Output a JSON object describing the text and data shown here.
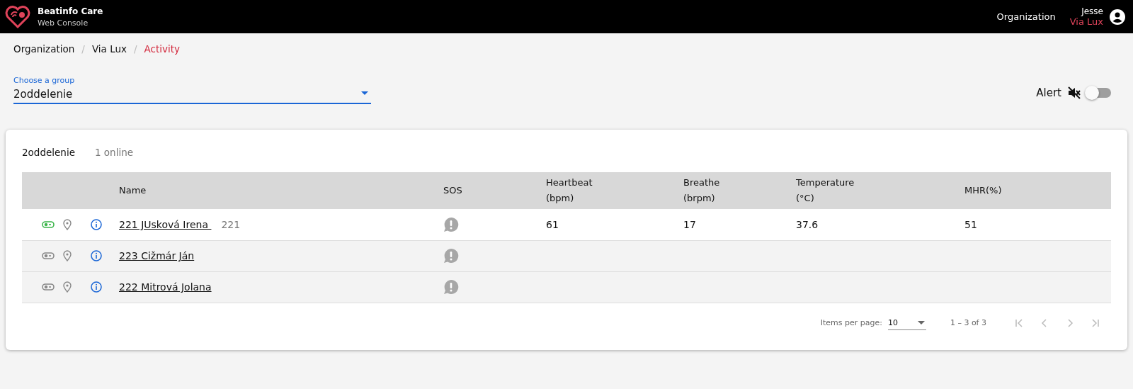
{
  "app": {
    "title": "Beatinfo Care",
    "subtitle": "Web Console"
  },
  "nav": {
    "link": "Organization",
    "user": "Jesse",
    "org": "Via Lux"
  },
  "breadcrumb_separator": "/",
  "breadcrumb": [
    {
      "label": "Organization",
      "current": false
    },
    {
      "label": "Via Lux",
      "current": false
    },
    {
      "label": "Activity",
      "current": true
    }
  ],
  "group_select": {
    "label": "Choose a group",
    "value": "2oddelenie"
  },
  "alert": {
    "label": "Alert",
    "on": false
  },
  "card": {
    "group": "2oddelenie",
    "online": "1 online"
  },
  "table": {
    "columns": [
      {
        "kind": "blank"
      },
      {
        "kind": "blank"
      },
      {
        "kind": "blank"
      },
      {
        "kind": "text",
        "lines": [
          "Name"
        ]
      },
      {
        "kind": "text",
        "lines": [
          "SOS"
        ]
      },
      {
        "kind": "text",
        "lines": [
          "Heartbeat",
          "(bpm)"
        ]
      },
      {
        "kind": "text",
        "lines": [
          "Breathe",
          "(brpm)"
        ]
      },
      {
        "kind": "text",
        "lines": [
          "Temperature",
          "(°C)"
        ]
      },
      {
        "kind": "text",
        "lines": [
          "MHR(%)"
        ]
      }
    ],
    "rows": [
      {
        "online": true,
        "name": "221 JUsková Irena ",
        "code": "221",
        "heartbeat": "61",
        "breathe": "17",
        "temperature": "37.6",
        "mhr": "51"
      },
      {
        "online": false,
        "name": "223 Cižmár Ján"
      },
      {
        "online": false,
        "name": "222 Mitrová Jolana"
      }
    ]
  },
  "paginator": {
    "label": "Items per page:",
    "page_size": "10",
    "range": "1 – 3 of 3",
    "first_disabled": true,
    "prev_disabled": true,
    "next_disabled": true,
    "last_disabled": true
  }
}
